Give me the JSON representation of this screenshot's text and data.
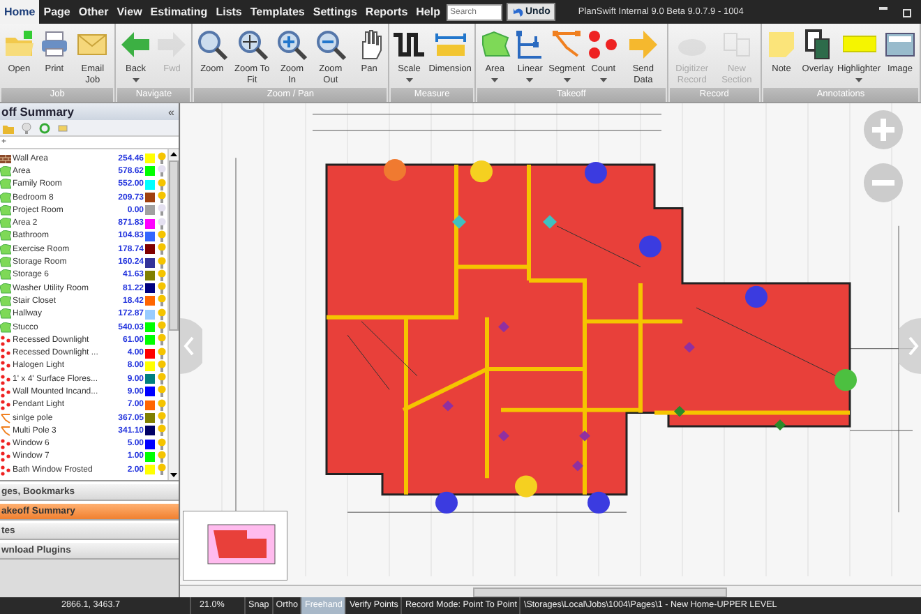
{
  "menu": {
    "tabs": [
      {
        "label": "Home",
        "selected": true
      },
      {
        "label": "Page",
        "selected": false
      },
      {
        "label": "Other",
        "selected": false
      },
      {
        "label": "View",
        "selected": false
      },
      {
        "label": "Estimating",
        "selected": false
      },
      {
        "label": "Lists",
        "selected": false
      },
      {
        "label": "Templates",
        "selected": false
      },
      {
        "label": "Settings",
        "selected": false
      },
      {
        "label": "Reports",
        "selected": false
      },
      {
        "label": "Help",
        "selected": false
      }
    ],
    "search": {
      "placeholder": "Search"
    },
    "undo": "Undo",
    "title": "PlanSwift Internal 9.0 Beta  9.0.7.9 - 1004"
  },
  "ribbon": [
    {
      "label": "Job",
      "buttons": [
        {
          "label": "Open",
          "dropdown": false,
          "disabled": false
        },
        {
          "label": "Print",
          "dropdown": false,
          "disabled": false
        },
        {
          "label": "Email Job",
          "dropdown": false,
          "disabled": false
        }
      ]
    },
    {
      "label": "Navigate",
      "buttons": [
        {
          "label": "Back",
          "dropdown": true,
          "disabled": false
        },
        {
          "label": "Fwd",
          "dropdown": false,
          "disabled": true
        }
      ]
    },
    {
      "label": "Zoom / Pan",
      "buttons": [
        {
          "label": "Zoom",
          "dropdown": false,
          "disabled": false
        },
        {
          "label": "Zoom To Fit",
          "dropdown": false,
          "disabled": false
        },
        {
          "label": "Zoom In",
          "dropdown": false,
          "disabled": false
        },
        {
          "label": "Zoom Out",
          "dropdown": false,
          "disabled": false
        },
        {
          "label": "Pan",
          "dropdown": false,
          "disabled": false
        }
      ]
    },
    {
      "label": "Measure",
      "buttons": [
        {
          "label": "Scale",
          "dropdown": true,
          "disabled": false
        },
        {
          "label": "Dimension",
          "dropdown": false,
          "disabled": false
        }
      ]
    },
    {
      "label": "Takeoff",
      "buttons": [
        {
          "label": "Area",
          "dropdown": true,
          "disabled": false
        },
        {
          "label": "Linear",
          "dropdown": true,
          "disabled": false
        },
        {
          "label": "Segment",
          "dropdown": true,
          "disabled": false
        },
        {
          "label": "Count",
          "dropdown": true,
          "disabled": false
        },
        {
          "label": "Send Data",
          "dropdown": false,
          "disabled": false
        }
      ]
    },
    {
      "label": "Record",
      "buttons": [
        {
          "label": "Digitizer Record",
          "dropdown": false,
          "disabled": true
        },
        {
          "label": "New Section",
          "dropdown": false,
          "disabled": true
        }
      ]
    },
    {
      "label": "Annotations",
      "buttons": [
        {
          "label": "Note",
          "dropdown": false,
          "disabled": false
        },
        {
          "label": "Overlay",
          "dropdown": false,
          "disabled": false
        },
        {
          "label": "Highlighter",
          "dropdown": true,
          "disabled": false
        },
        {
          "label": "Image",
          "dropdown": false,
          "disabled": false
        }
      ]
    }
  ],
  "panel": {
    "title": "off Summary",
    "collapse_glyph": "«",
    "filter_glyph": "+",
    "items": [
      {
        "kind": "linear",
        "name": "Wall Area",
        "value": "254.46",
        "color": "#ffff00",
        "on": true
      },
      {
        "kind": "area",
        "name": "Area",
        "value": "578.62",
        "color": "#00ff00",
        "on": false
      },
      {
        "kind": "area",
        "name": "Family Room",
        "value": "552.00",
        "color": "#00ffff",
        "on": true
      },
      {
        "kind": "area",
        "name": "Bedroom 8",
        "value": "209.73",
        "color": "#a0400f",
        "on": true
      },
      {
        "kind": "area",
        "name": "Project Room",
        "value": "0.00",
        "color": "#a0a0a0",
        "on": false
      },
      {
        "kind": "area",
        "name": "Area 2",
        "value": "871.83",
        "color": "#ff00ff",
        "on": false
      },
      {
        "kind": "area",
        "name": "Bathroom",
        "value": "104.83",
        "color": "#3366ff",
        "on": true
      },
      {
        "kind": "area",
        "name": "Exercise Room",
        "value": "178.74",
        "color": "#800000",
        "on": true
      },
      {
        "kind": "area",
        "name": "Storage Room",
        "value": "160.24",
        "color": "#333399",
        "on": true
      },
      {
        "kind": "area",
        "name": "Storage 6",
        "value": "41.63",
        "color": "#808000",
        "on": true
      },
      {
        "kind": "area",
        "name": "Washer Utility Room",
        "value": "81.22",
        "color": "#000080",
        "on": true
      },
      {
        "kind": "area",
        "name": "Stair Closet",
        "value": "18.42",
        "color": "#ff6600",
        "on": true
      },
      {
        "kind": "area",
        "name": "Hallway",
        "value": "172.87",
        "color": "#99ccff",
        "on": true
      },
      {
        "kind": "area",
        "name": "Stucco",
        "value": "540.03",
        "color": "#00ff00",
        "on": true
      },
      {
        "kind": "count",
        "name": "Recessed Downlight",
        "value": "61.00",
        "color": "#00ff00",
        "on": true
      },
      {
        "kind": "count",
        "name": "Recessed Downlight ...",
        "value": "4.00",
        "color": "#ff0000",
        "on": true
      },
      {
        "kind": "count",
        "name": "Halogen Light",
        "value": "8.00",
        "color": "#ffff00",
        "on": true
      },
      {
        "kind": "count",
        "name": "1' x 4' Surface Flores...",
        "value": "9.00",
        "color": "#008080",
        "on": true
      },
      {
        "kind": "count",
        "name": "Wall Mounted Incand...",
        "value": "9.00",
        "color": "#0000ff",
        "on": true
      },
      {
        "kind": "count",
        "name": "Pendant Light",
        "value": "7.00",
        "color": "#ff6600",
        "on": true
      },
      {
        "kind": "segment",
        "name": "sinlge pole",
        "value": "367.05",
        "color": "#808000",
        "on": true
      },
      {
        "kind": "segment",
        "name": "Multi Pole 3",
        "value": "341.10",
        "color": "#000066",
        "on": true
      },
      {
        "kind": "count",
        "name": "Window 6",
        "value": "5.00",
        "color": "#0000ff",
        "on": true
      },
      {
        "kind": "count",
        "name": "Window 7",
        "value": "1.00",
        "color": "#00ff00",
        "on": true
      },
      {
        "kind": "count",
        "name": "Bath Window Frosted",
        "value": "2.00",
        "color": "#ffff00",
        "on": true
      }
    ],
    "sections": [
      {
        "label": "ges, Bookmarks",
        "selected": false
      },
      {
        "label": "akeoff Summary",
        "selected": true
      },
      {
        "label": "tes",
        "selected": false
      },
      {
        "label": "wnload Plugins",
        "selected": false
      }
    ]
  },
  "status_bar": {
    "coordinates": "2866.1, 3463.7",
    "zoom": "21.0%",
    "toggles": [
      {
        "label": "Snap",
        "selected": false
      },
      {
        "label": "Ortho",
        "selected": false
      },
      {
        "label": "Freehand",
        "selected": true
      },
      {
        "label": "Verify Points",
        "selected": false
      }
    ],
    "record_mode": "Record Mode: Point To Point",
    "path": "\\Storages\\Local\\Jobs\\1004\\Pages\\1 - New Home-UPPER LEVEL"
  }
}
